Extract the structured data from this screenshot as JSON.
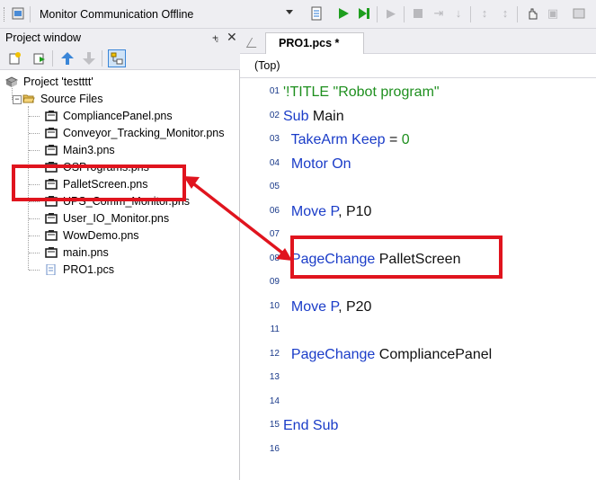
{
  "toolbar": {
    "connection_combo": "Monitor Communication  Offline",
    "icons": [
      "project-icon",
      "document-icon",
      "run-icon",
      "step-run-icon",
      "cursor-icon",
      "stop-icon",
      "step-into-icon",
      "step-over-icon",
      "step-out-icon",
      "breakpoint-icon",
      "hand-icon",
      "clear-icon"
    ]
  },
  "project_window": {
    "title": "Project window",
    "pin_glyph": "⨧",
    "close_glyph": "✕",
    "tools": [
      "new-file-icon",
      "import-icon",
      "move-up-icon",
      "move-down-icon",
      "properties-icon"
    ],
    "tree": {
      "root": "Project 'testttt'",
      "folder": "Source Files",
      "files": [
        "CompliancePanel.pns",
        "Conveyor_Tracking_Monitor.pns",
        "Main3.pns",
        "OSPrograms.pns",
        "PalletScreen.pns",
        "UPS_Comm_Monitor.pns",
        "User_IO_Monitor.pns",
        "WowDemo.pns",
        "main.pns",
        "PRO1.pcs"
      ]
    }
  },
  "editor": {
    "tab_label": "PRO1.pcs *",
    "scope": "(Top)",
    "lines": [
      {
        "num": "01",
        "parts": [
          {
            "text": "'!TITLE \"Robot program\"",
            "color": "green"
          }
        ]
      },
      {
        "num": "02",
        "parts": [
          {
            "text": "Sub",
            "color": "blue"
          },
          {
            "text": " Main",
            "color": "dark"
          }
        ]
      },
      {
        "num": "03",
        "parts": [
          {
            "text": "  TakeArm Keep",
            "color": "blue"
          },
          {
            "text": " = ",
            "color": "dark"
          },
          {
            "text": "0",
            "color": "green"
          }
        ]
      },
      {
        "num": "04",
        "parts": [
          {
            "text": "  Motor On",
            "color": "blue"
          }
        ]
      },
      {
        "num": "05",
        "parts": []
      },
      {
        "num": "06",
        "parts": [
          {
            "text": "  Move P",
            "color": "blue"
          },
          {
            "text": ", P10",
            "color": "dark"
          }
        ]
      },
      {
        "num": "07",
        "parts": []
      },
      {
        "num": "08",
        "parts": [
          {
            "text": "  PageChange",
            "color": "blue"
          },
          {
            "text": " PalletScreen",
            "color": "dark"
          }
        ]
      },
      {
        "num": "09",
        "parts": []
      },
      {
        "num": "10",
        "parts": [
          {
            "text": "  Move P",
            "color": "blue"
          },
          {
            "text": ", P20",
            "color": "dark"
          }
        ]
      },
      {
        "num": "11",
        "parts": []
      },
      {
        "num": "12",
        "parts": [
          {
            "text": "  PageChange",
            "color": "blue"
          },
          {
            "text": " CompliancePanel",
            "color": "dark"
          }
        ]
      },
      {
        "num": "13",
        "parts": []
      },
      {
        "num": "14",
        "parts": []
      },
      {
        "num": "15",
        "parts": [
          {
            "text": "End Sub",
            "color": "blue"
          }
        ]
      },
      {
        "num": "16",
        "parts": []
      }
    ]
  },
  "colors": {
    "annotation": "#e0141e",
    "keyword_blue": "#1a3cc8",
    "comment_green": "#1e8f1e",
    "line_number": "#1a3a8a"
  }
}
